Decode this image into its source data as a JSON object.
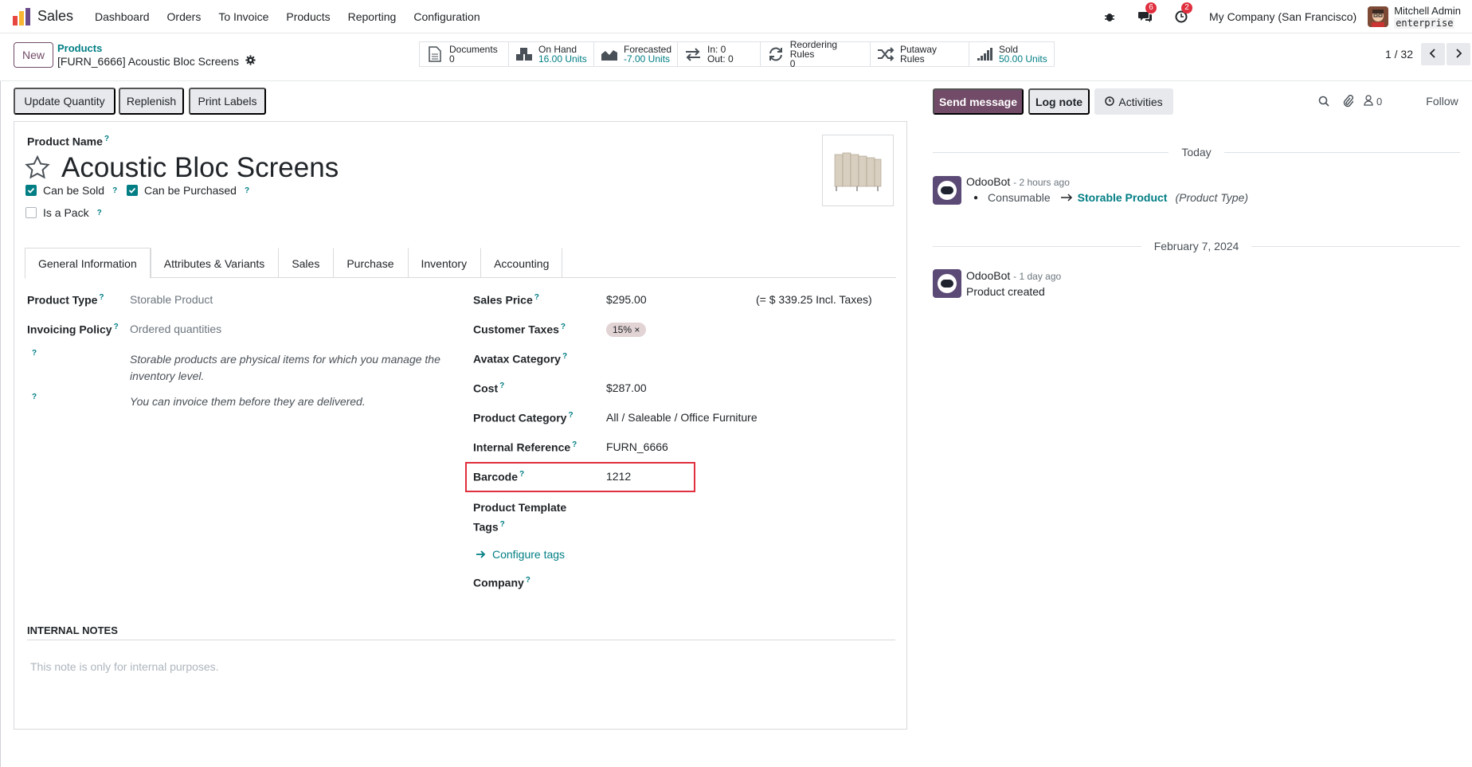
{
  "navbar": {
    "app_name": "Sales",
    "menu": [
      "Dashboard",
      "Orders",
      "To Invoice",
      "Products",
      "Reporting",
      "Configuration"
    ],
    "messages_count": "6",
    "activities_count": "2",
    "company": "My Company (San Francisco)",
    "user_name": "Mitchell Admin",
    "db_name": "enterprise"
  },
  "control": {
    "new_label": "New",
    "breadcrumb_parent": "Products",
    "breadcrumb_current": "[FURN_6666] Acoustic Bloc Screens",
    "stats": [
      {
        "name": "documents",
        "label": "Documents",
        "value": "0",
        "teal": false
      },
      {
        "name": "on-hand",
        "label": "On Hand",
        "value": "16.00 Units",
        "teal": true
      },
      {
        "name": "forecasted",
        "label": "Forecasted",
        "value": "-7.00 Units",
        "teal": true
      },
      {
        "name": "in-out",
        "label": "In: 0",
        "value": "Out: 0",
        "teal": false
      },
      {
        "name": "reordering-rules",
        "label": "Reordering Rules",
        "value": "0",
        "teal": false
      },
      {
        "name": "putaway-rules",
        "label": "Putaway Rules",
        "value": "",
        "teal": false
      },
      {
        "name": "sold",
        "label": "Sold",
        "value": "50.00 Units",
        "teal": true
      }
    ],
    "pager": "1 / 32"
  },
  "actions": {
    "update_quantity": "Update Quantity",
    "replenish": "Replenish",
    "print_labels": "Print Labels"
  },
  "form": {
    "product_name_label": "Product Name",
    "product_name": "Acoustic Bloc Screens",
    "can_be_sold": "Can be Sold",
    "can_be_purchased": "Can be Purchased",
    "is_a_pack": "Is a Pack",
    "tabs": [
      "General Information",
      "Attributes & Variants",
      "Sales",
      "Purchase",
      "Inventory",
      "Accounting"
    ],
    "left": {
      "product_type_label": "Product Type",
      "product_type": "Storable Product",
      "invoicing_policy_label": "Invoicing Policy",
      "invoicing_policy": "Ordered quantities",
      "help_1": "Storable products are physical items for which you manage the inventory level.",
      "help_2": "You can invoice them before they are delivered."
    },
    "right": {
      "sales_price_label": "Sales Price",
      "sales_price": "$295.00",
      "incl_taxes": "(= $ 339.25 Incl. Taxes)",
      "customer_taxes_label": "Customer Taxes",
      "customer_tax_tag": "15% ×",
      "avatax_label": "Avatax Category",
      "cost_label": "Cost",
      "cost": "$287.00",
      "category_label": "Product Category",
      "category": "All / Saleable / Office Furniture",
      "internal_ref_label": "Internal Reference",
      "internal_ref": "FURN_6666",
      "barcode_label": "Barcode",
      "barcode": "1212",
      "tags_label_1": "Product Template",
      "tags_label_2": "Tags",
      "configure_tags": "Configure tags",
      "company_label": "Company"
    },
    "internal_notes_label": "INTERNAL NOTES",
    "internal_notes_placeholder": "This note is only for internal purposes."
  },
  "chatter": {
    "send_message": "Send message",
    "log_note": "Log note",
    "activities": "Activities",
    "followers_count": "0",
    "follow": "Follow",
    "today": "Today",
    "msg1_author": "OdooBot",
    "msg1_time": "- 2 hours ago",
    "msg1_old": "Consumable",
    "msg1_new": "Storable Product",
    "msg1_field": "(Product Type)",
    "date2": "February 7, 2024",
    "msg2_author": "OdooBot",
    "msg2_time": "- 1 day ago",
    "msg2_body": "Product created"
  },
  "colors": {
    "brand": "#714b67",
    "accent": "#017e84",
    "badge": "#e02f3e",
    "highlight": "#e02f3e"
  }
}
